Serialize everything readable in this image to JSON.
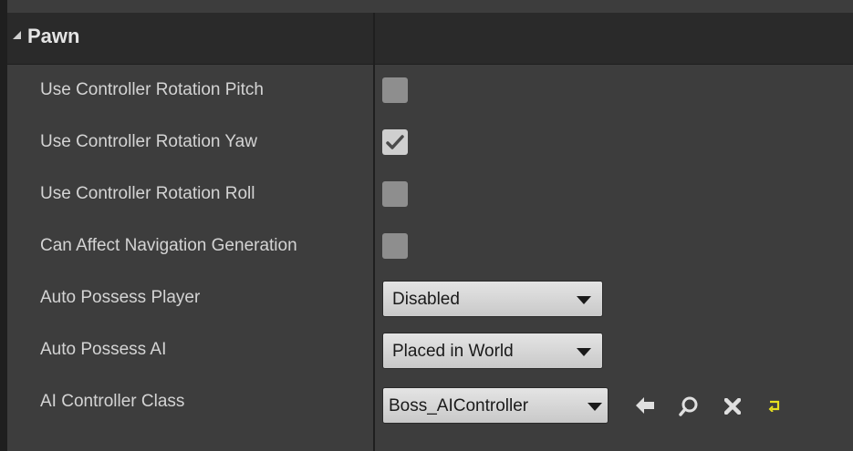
{
  "section": {
    "title": "Pawn"
  },
  "rows": [
    {
      "label": "Use Controller Rotation Pitch",
      "checked": false
    },
    {
      "label": "Use Controller Rotation Yaw",
      "checked": true
    },
    {
      "label": "Use Controller Rotation Roll",
      "checked": false
    },
    {
      "label": "Can Affect Navigation Generation",
      "checked": false
    },
    {
      "label": "Auto Possess Player",
      "value": "Disabled"
    },
    {
      "label": "Auto Possess AI",
      "value": "Placed in World"
    },
    {
      "label": "AI Controller Class",
      "value": "Boss_AIController"
    }
  ],
  "icons": [
    "arrow-left-icon",
    "browse-icon",
    "clear-icon",
    "reset-to-default-icon"
  ],
  "colors": {
    "background": "#3d3d3d",
    "header": "#2a2a2a",
    "reset_icon": "#e8e020"
  }
}
